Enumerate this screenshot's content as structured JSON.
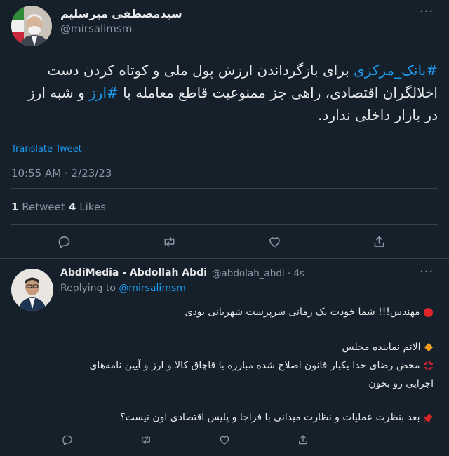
{
  "main_tweet": {
    "author_name": "سیدمصطفی میرسلیم",
    "author_handle": "@mirsalimsm",
    "more": "···",
    "body": {
      "line1_tag": "#بانک_مرکزی",
      "line1_rest": " برای بازگرداندن ارزش پول ملی و کوتاه کردن دست",
      "line2_start": "اخلالگران اقتصادی، راهی جز ممنوعیت قاطع معامله با ",
      "line2_tag": "#ارز",
      "line2_end": " و شبه ارز",
      "line3": "در بازار داخلی ندارد."
    },
    "translate": "Translate Tweet",
    "timestamp": "10:55 AM · 2/23/23",
    "retweets_count": "1",
    "retweets_label": "Retweet",
    "likes_count": "4",
    "likes_label": "Likes"
  },
  "reply": {
    "author_name": "AbdiMedia - Abdollah Abdi",
    "author_handle": "@abdolah_abdi",
    "time": "· 4s",
    "more": "···",
    "replying_to_label": "Replying to ",
    "replying_to_handle": "@mirsalimsm",
    "lines": [
      "مهندس!!! شما خودت یک زمانی سرپرست شهربانی بودی",
      "الانم نماینده مجلس",
      "محض رضای خدا یکبار قانون اصلاح شده مبارزه با قاچاق کالا و ارز و آیین نامه‌های",
      "اجرایی رو بخون",
      "بعد بنظرت عملیات و نظارت میدانی با فراجا و پلیس اقتصادی اون نیست؟"
    ]
  },
  "icons": {
    "reply": "comment-icon",
    "retweet": "retweet-icon",
    "like": "heart-icon",
    "share": "share-icon",
    "red_circle": "red-circle-emoji",
    "orange_diamond": "orange-diamond-emoji",
    "anger": "anger-symbol-emoji",
    "pin": "pushpin-emoji"
  },
  "colors": {
    "background": "#15202b",
    "link": "#1d9bf0",
    "muted": "#8b98a5",
    "text": "#e7e9ea"
  }
}
